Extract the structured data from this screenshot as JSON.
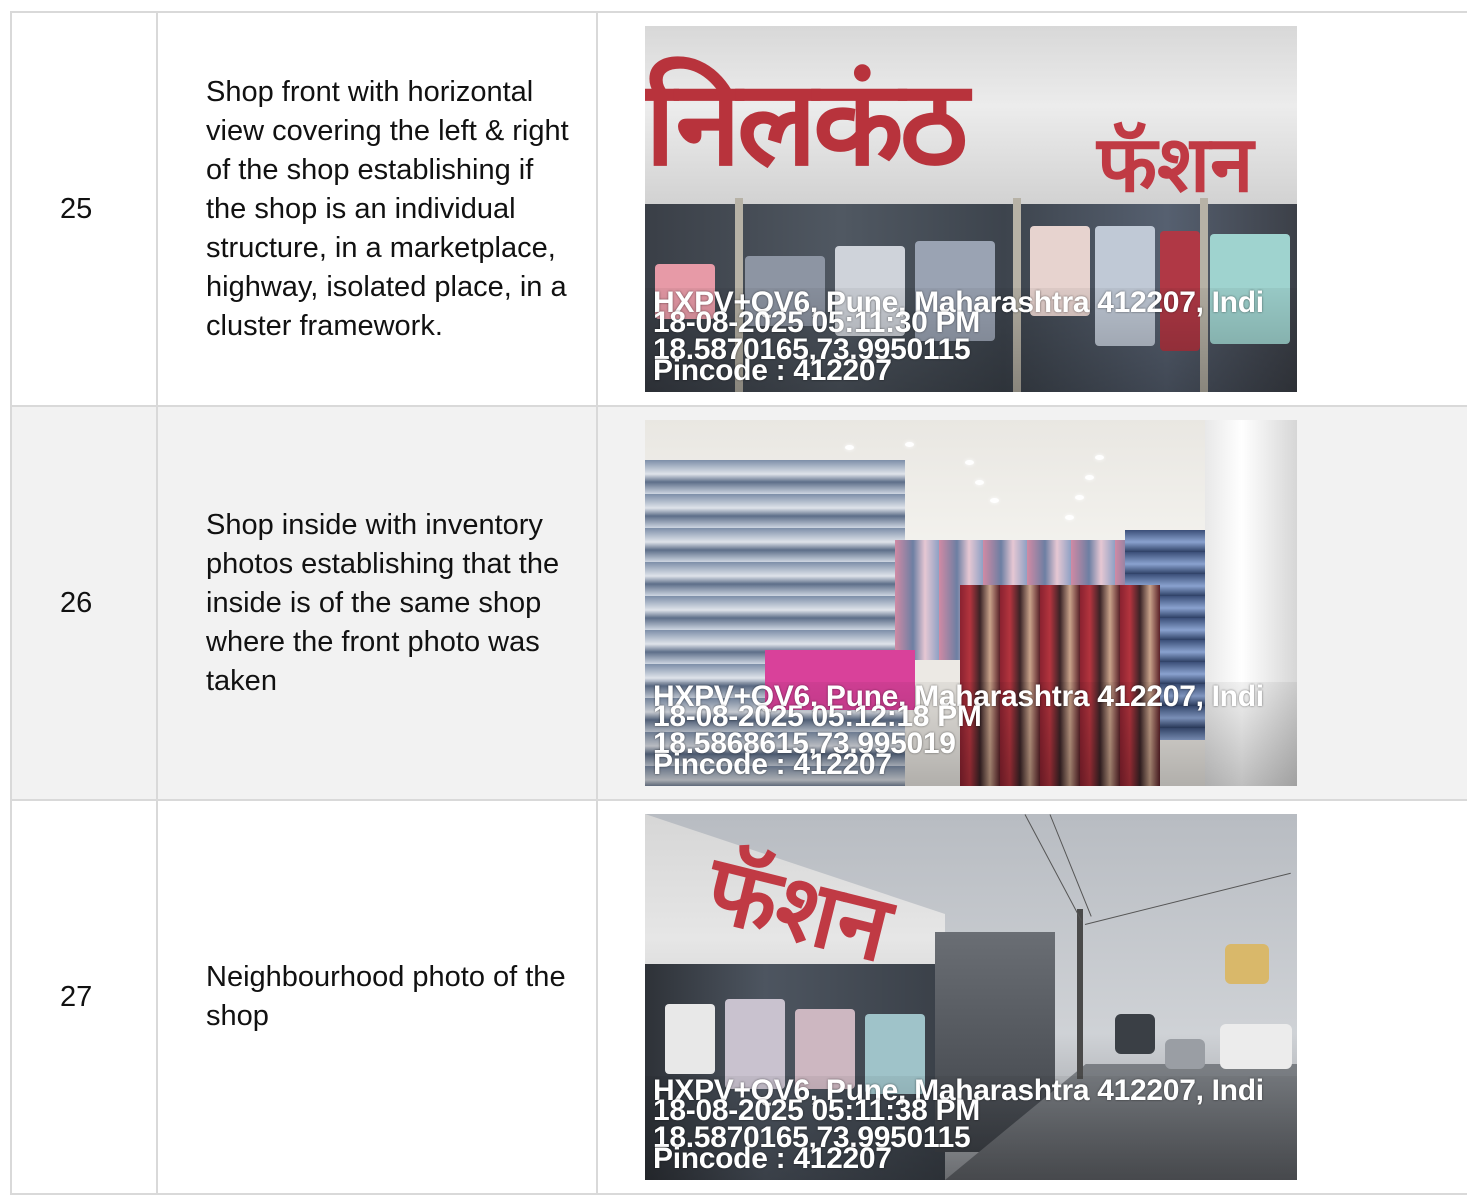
{
  "rows": [
    {
      "number": "25",
      "description": "Shop front with horizontal view covering the left & right of the shop establishing if the shop is an individual structure, in a marketplace, highway, isolated place, in a cluster framework.",
      "photo": {
        "sign_text": "निलकंठ",
        "sign_text_2": "फॅशन",
        "stamp_address": "HXPV+QV6, Pune, Maharashtra 412207, Indi",
        "stamp_datetime": "18-08-2025 05:11:30 PM",
        "stamp_coords": "18.5870165,73.9950115",
        "stamp_pincode": "Pincode : 412207"
      }
    },
    {
      "number": "26",
      "description": "Shop inside with inventory photos establishing that the inside is of the same shop where the front photo was taken",
      "photo": {
        "stamp_address": "HXPV+QV6, Pune, Maharashtra 412207, Indi",
        "stamp_datetime": "18-08-2025 05:12:18 PM",
        "stamp_coords": "18.5868615,73.995019",
        "stamp_pincode": "Pincode : 412207"
      }
    },
    {
      "number": "27",
      "description": "Neighbourhood photo of the shop",
      "photo": {
        "sign_text": "फॅशन",
        "stamp_address": "HXPV+QV6, Pune, Maharashtra 412207, Indi",
        "stamp_datetime": "18-08-2025 05:11:38 PM",
        "stamp_coords": "18.5870165,73.9950115",
        "stamp_pincode": "Pincode : 412207"
      }
    }
  ]
}
